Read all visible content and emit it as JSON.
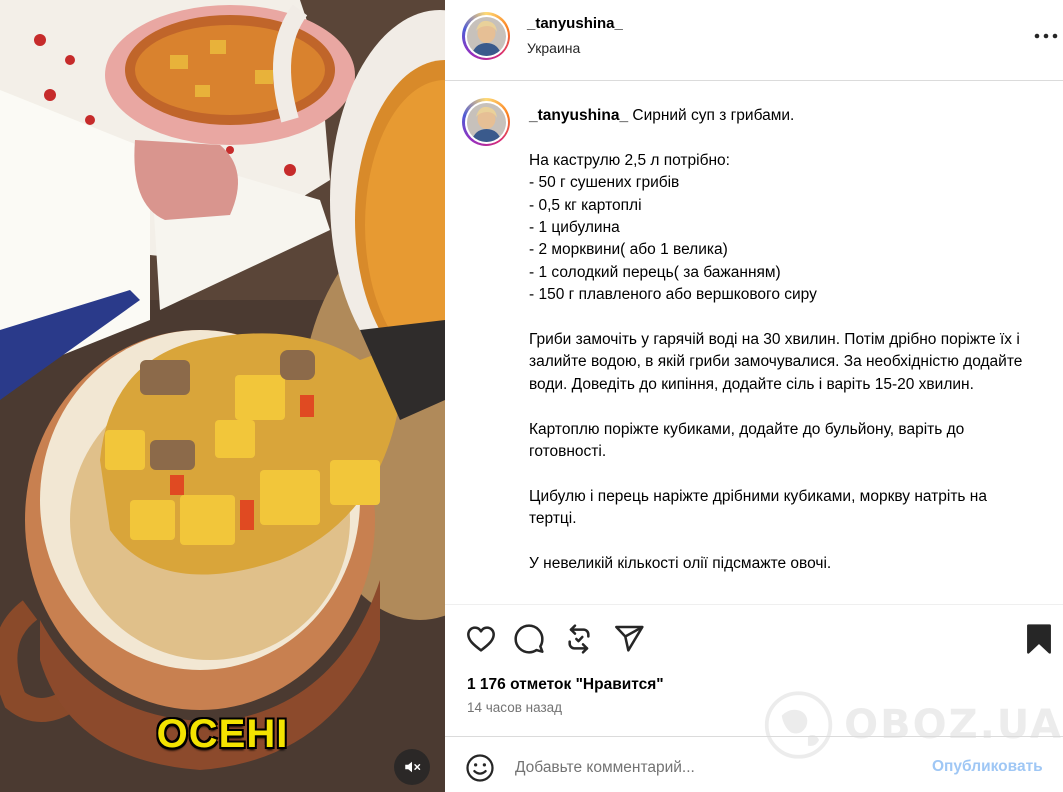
{
  "media": {
    "overlay_text": "ОСЕНІ",
    "mute_icon": "speaker-muted-icon"
  },
  "header": {
    "username": "_tanyushina_",
    "location": "Украина",
    "more_icon": "more-horizontal-icon"
  },
  "post": {
    "username": "_tanyushina_",
    "caption": " Сирний суп з грибами.\n\nНа каструлю 2,5 л потрібно:\n- 50 г сушених грибів\n- 0,5 кг картоплі\n- 1 цибулина\n- 2 морквини( або 1 велика)\n- 1 солодкий перець( за бажанням)\n- 150 г плавленого або вершкового сиру\n\nГриби замочіть у гарячій воді на 30 хвилин. Потім дрібно поріжте їх і залийте водою, в якій гриби замочувалися. За необхідністю додайте води. Доведіть до кипіння, додайте сіль і варіть 15-20 хвилин.\n\nКартоплю поріжте кубиками, додайте до бульйону, варіть до готовності.\n\nЦибулю і перець наріжте дрібними кубиками, моркву натріть на тертці.\n\nУ невеликій кількості олії підсмажте овочі."
  },
  "actions": {
    "like_icon": "heart-icon",
    "comment_icon": "comment-icon",
    "repost_icon": "repost-icon",
    "share_icon": "send-icon",
    "save_icon": "bookmark-filled-icon"
  },
  "stats": {
    "likes": "1 176 отметок \"Нравится\"",
    "time": "14 часов назад"
  },
  "watermark": "OBOZ.UA",
  "comment": {
    "placeholder": "Добавьте комментарий...",
    "publish_label": "Опубликовать"
  },
  "colors": {
    "publish": "#9fc7f5",
    "overlay_text": "#f3e300"
  }
}
